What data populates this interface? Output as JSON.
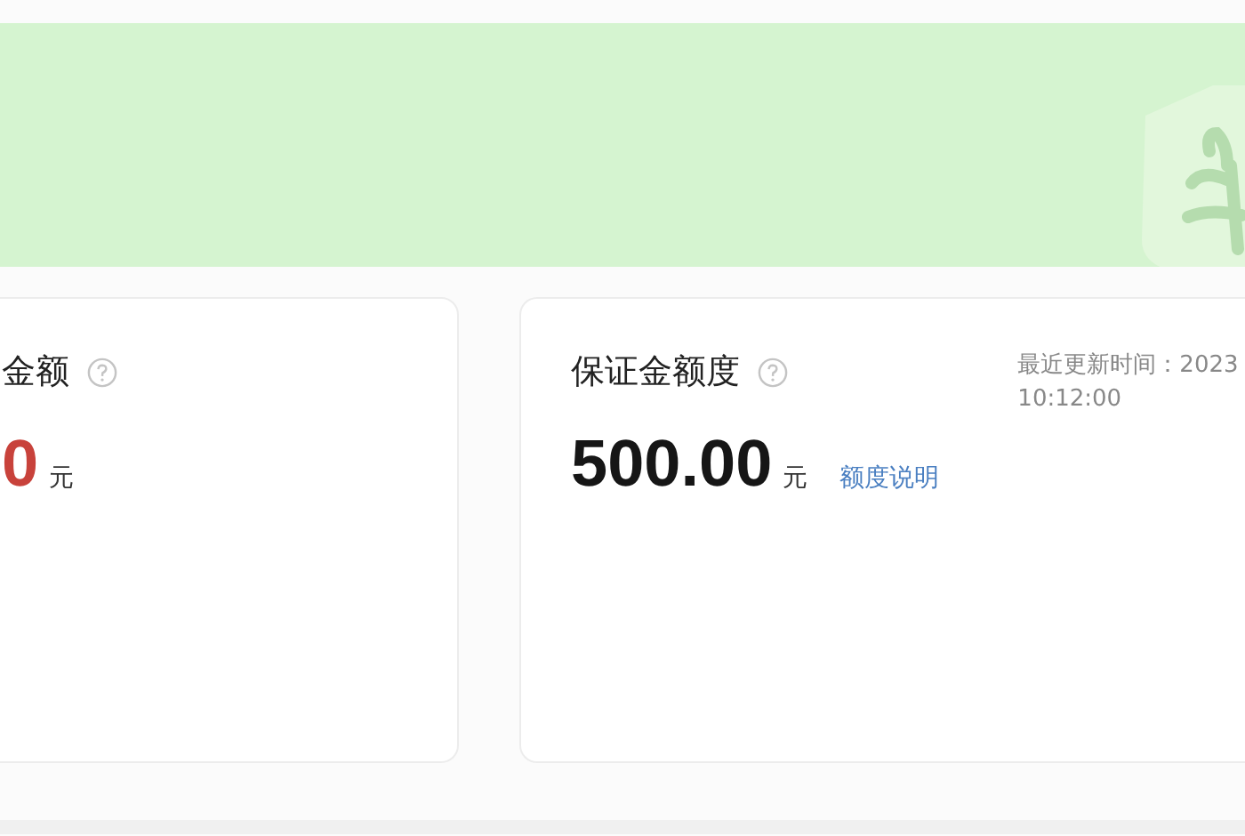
{
  "cards": [
    {
      "kind": "warning",
      "title": "金额",
      "value": "0",
      "unit": "元"
    },
    {
      "kind": "normal",
      "title": "保证金额度",
      "value": "500.00",
      "unit": "元",
      "link": "额度说明",
      "updated": [
        "最近更新时间：2023",
        "10:12:00"
      ]
    }
  ]
}
